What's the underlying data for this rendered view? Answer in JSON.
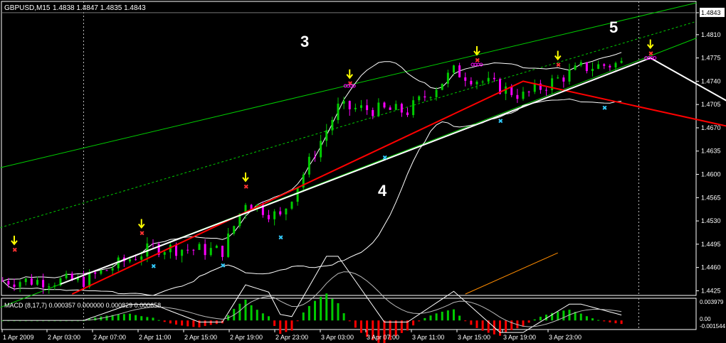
{
  "header": {
    "symbol": "GBPUSD,M15",
    "ohlc": "1.4838 1.4847 1.4835 1.4843"
  },
  "colors": {
    "background": "#000000",
    "axis": "#ffffff",
    "bull": "#00cc00",
    "bear": "#ff00ff",
    "bollinger": "#ffffff",
    "channel": "#00cc00",
    "zigzag_red": "#ff0000",
    "zigzag_white": "#ffffff",
    "wedge": "#ffc000",
    "target_arrow": "#ff8c00",
    "fractal_up": "#ffff00",
    "fractal_down": "#00ff66",
    "star_up": "#ff3333",
    "star_down": "#33ccff",
    "macd_pos": "#00cc00",
    "macd_neg": "#ff0000",
    "orange_line": "#ff8c00"
  },
  "annotations": [
    {
      "text": "3",
      "x": "3 Apr 00:30",
      "y": 1.4828
    },
    {
      "text": "4",
      "x": "3 Apr 07:00",
      "y": 1.4583
    },
    {
      "text": "5",
      "x": "3 Apr 23:30",
      "y": 1.483
    }
  ],
  "chart_data": [
    {
      "type": "candlestick",
      "title": "GBPUSD,M15",
      "x_ticks": [
        "1 Apr 2009",
        "2 Apr 03:00",
        "2 Apr 07:00",
        "2 Apr 11:00",
        "2 Apr 15:00",
        "2 Apr 19:00",
        "2 Apr 23:00",
        "3 Apr 03:00",
        "3 Apr 07:00",
        "3 Apr 11:00",
        "3 Apr 15:00",
        "3 Apr 19:00",
        "3 Apr 23:00"
      ],
      "y_ticks": [
        "1.4843",
        "1.4810",
        "1.4775",
        "1.4740",
        "1.4705",
        "1.4670",
        "1.4635",
        "1.4600",
        "1.4565",
        "1.4530",
        "1.4495",
        "1.4460",
        "1.4425"
      ],
      "ylim": [
        1.4418,
        1.486
      ],
      "current_price": 1.4843,
      "price_path": [
        {
          "x": "2 Apr 00:00",
          "y": 1.444
        },
        {
          "x": "2 Apr 03:00",
          "y": 1.449
        },
        {
          "x": "2 Apr 06:00",
          "y": 1.4485
        },
        {
          "x": "2 Apr 07:00",
          "y": 1.456
        },
        {
          "x": "2 Apr 08:30",
          "y": 1.4535
        },
        {
          "x": "2 Apr 11:00",
          "y": 1.47
        },
        {
          "x": "2 Apr 14:00",
          "y": 1.4695
        },
        {
          "x": "2 Apr 16:00",
          "y": 1.4755
        },
        {
          "x": "2 Apr 19:00",
          "y": 1.4718
        },
        {
          "x": "2 Apr 21:30",
          "y": 1.476
        },
        {
          "x": "3 Apr 00:30",
          "y": 1.4772
        },
        {
          "x": "3 Apr 03:00",
          "y": 1.4712
        },
        {
          "x": "3 Apr 04:30",
          "y": 1.469
        },
        {
          "x": "3 Apr 07:00",
          "y": 1.4648
        },
        {
          "x": "3 Apr 08:00",
          "y": 1.469
        },
        {
          "x": "3 Apr 09:00",
          "y": 1.482
        },
        {
          "x": "3 Apr 11:00",
          "y": 1.4735
        },
        {
          "x": "3 Apr 14:00",
          "y": 1.4828
        },
        {
          "x": "3 Apr 17:00",
          "y": 1.479
        },
        {
          "x": "3 Apr 20:00",
          "y": 1.4815
        },
        {
          "x": "3 Apr 23:00",
          "y": 1.4843
        }
      ],
      "zigzag_red": [
        {
          "x": "1 Apr 23:30",
          "y": 1.442
        },
        {
          "x": "2 Apr 19:00",
          "y": 1.474
        },
        {
          "x": "3 Apr 07:00",
          "y": 1.4648
        },
        {
          "x": "3 Apr 08:30",
          "y": 1.4818
        },
        {
          "x": "3 Apr 11:00",
          "y": 1.4728
        },
        {
          "x": "3 Apr 22:30",
          "y": 1.4822
        }
      ],
      "zigzag_white": [
        {
          "x": "1 Apr 23:00",
          "y": 1.4435
        },
        {
          "x": "3 Apr 00:30",
          "y": 1.4775
        },
        {
          "x": "3 Apr 07:00",
          "y": 1.4648
        },
        {
          "x": "3 Apr 11:00",
          "y": 1.4712
        },
        {
          "x": "3 Apr 23:00",
          "y": 1.4843
        }
      ],
      "wedge_upper": [
        {
          "x": "3 Apr 08:00",
          "y": 1.4822
        },
        {
          "x": "4 Apr 03:00",
          "y": 1.4865
        }
      ],
      "wedge_lower": [
        {
          "x": "3 Apr 11:00",
          "y": 1.4728
        },
        {
          "x": "4 Apr 01:00",
          "y": 1.4865
        }
      ],
      "target_arrow": [
        {
          "x": "3 Apr 22:30",
          "y": 1.4822
        },
        {
          "x": "4 Apr 01:30",
          "y": 1.47
        }
      ]
    },
    {
      "type": "bar",
      "title": "MACD (8,17,7) 0.000357 0.000000 0.000829 0.000658",
      "y_ticks": [
        "0.003979",
        "0.00",
        "-0.001544"
      ],
      "ylim": [
        -0.001544,
        0.003979
      ]
    }
  ]
}
